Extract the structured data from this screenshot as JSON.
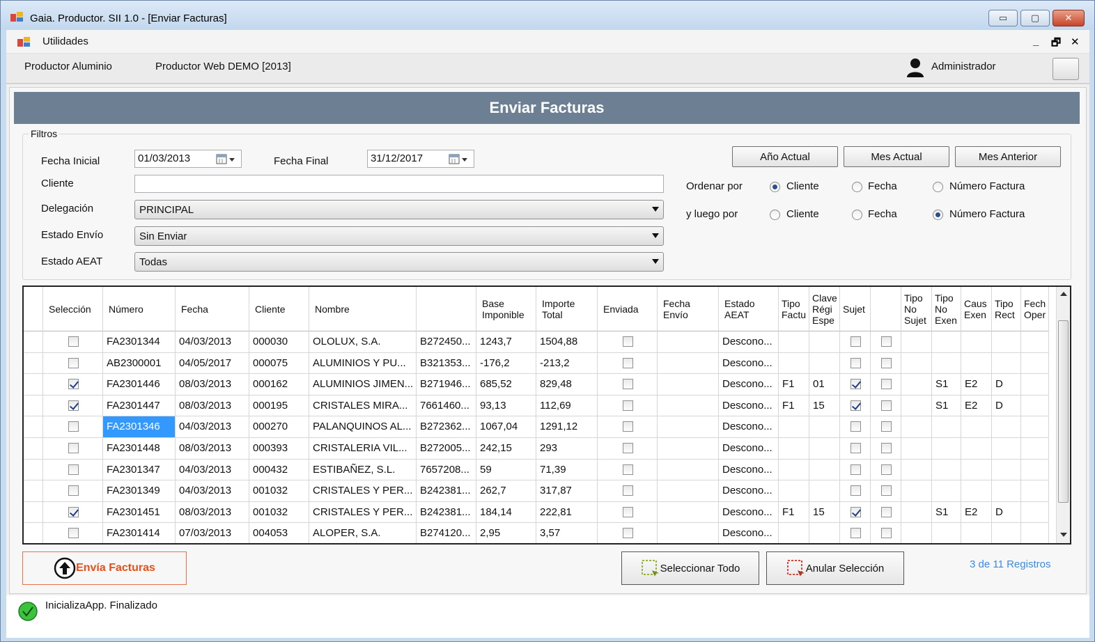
{
  "window": {
    "title": "Gaia. Productor. SII 1.0 - [Enviar Facturas]",
    "controls": {
      "minimize": "▭",
      "maximize": "▢",
      "close": "✕"
    }
  },
  "menu": {
    "items": [
      "Utilidades"
    ],
    "mdi": {
      "minimize": "_",
      "restore": "🗗",
      "close": "✕"
    }
  },
  "info": {
    "company": "Productor Aluminio",
    "environment": "Productor Web DEMO [2013]",
    "user": "Administrador"
  },
  "page": {
    "title": "Enviar Facturas"
  },
  "filters": {
    "legend": "Filtros",
    "fecha_inicial_label": "Fecha Inicial",
    "fecha_inicial": "01/03/2013",
    "fecha_final_label": "Fecha Final",
    "fecha_final": "31/12/2017",
    "cliente_label": "Cliente",
    "cliente_value": "",
    "delegacion_label": "Delegación",
    "delegacion": "PRINCIPAL",
    "estado_envio_label": "Estado Envío",
    "estado_envio": "Sin Enviar",
    "estado_aeat_label": "Estado AEAT",
    "estado_aeat": "Todas",
    "buttons": {
      "anio_actual": "Año Actual",
      "mes_actual": "Mes Actual",
      "mes_anterior": "Mes Anterior"
    },
    "ordenar_label": "Ordenar por",
    "luego_label": "y luego por",
    "radio_options": [
      "Cliente",
      "Fecha",
      "Número Factura"
    ],
    "ordenar_selected": 0,
    "luego_selected": 2
  },
  "grid": {
    "headers": [
      "Selección",
      "Número",
      "Fecha",
      "Cliente",
      "Nombre",
      "",
      "Base\nImponible",
      "Importe\nTotal",
      "Enviada",
      "Fecha\nEnvío",
      "Estado\nAEAT",
      "Tipo\nFactu",
      "Clave\nRégi\nEspe",
      "Sujet",
      "",
      "Tipo\nNo\nSujet",
      "Tipo\nNo\nExen",
      "Caus\nExen",
      "Tipo\nRect",
      "Fech\nOper"
    ],
    "rows": [
      {
        "sel": false,
        "numero": "FA2301344",
        "fecha": "04/03/2013",
        "cliente": "000030",
        "nombre": "OLOLUX, S.A.",
        "nif": "B272450...",
        "base": "1243,7",
        "total": "1504,88",
        "enviada": false,
        "fenvio": "",
        "estado": "Descono...",
        "tipo": "",
        "clave": "",
        "sujeta": false,
        "extra": false,
        "tns": "",
        "tne": "",
        "caus": "",
        "rect": "",
        "foper": ""
      },
      {
        "sel": false,
        "numero": "AB2300001",
        "fecha": "04/05/2017",
        "cliente": "000075",
        "nombre": "ALUMINIOS Y PU...",
        "nif": "B321353...",
        "base": "-176,2",
        "total": "-213,2",
        "enviada": false,
        "fenvio": "",
        "estado": "Descono...",
        "tipo": "",
        "clave": "",
        "sujeta": false,
        "extra": false,
        "tns": "",
        "tne": "",
        "caus": "",
        "rect": "",
        "foper": ""
      },
      {
        "sel": true,
        "numero": "FA2301446",
        "fecha": "08/03/2013",
        "cliente": "000162",
        "nombre": "ALUMINIOS JIMEN...",
        "nif": "B271946...",
        "base": "685,52",
        "total": "829,48",
        "enviada": false,
        "fenvio": "",
        "estado": "Descono...",
        "tipo": "F1",
        "clave": "01",
        "sujeta": true,
        "extra": false,
        "tns": "",
        "tne": "S1",
        "caus": "E2",
        "rect": "D",
        "foper": ""
      },
      {
        "sel": true,
        "numero": "FA2301447",
        "fecha": "08/03/2013",
        "cliente": "000195",
        "nombre": "CRISTALES MIRA...",
        "nif": "7661460...",
        "base": "93,13",
        "total": "112,69",
        "enviada": false,
        "fenvio": "",
        "estado": "Descono...",
        "tipo": "F1",
        "clave": "15",
        "sujeta": true,
        "extra": false,
        "tns": "",
        "tne": "S1",
        "caus": "E2",
        "rect": "D",
        "foper": ""
      },
      {
        "sel": false,
        "numero": "FA2301346",
        "fecha": "04/03/2013",
        "cliente": "000270",
        "nombre": "PALANQUINOS AL...",
        "nif": "B272362...",
        "base": "1067,04",
        "total": "1291,12",
        "enviada": false,
        "fenvio": "",
        "estado": "Descono...",
        "tipo": "",
        "clave": "",
        "sujeta": false,
        "extra": false,
        "tns": "",
        "tne": "",
        "caus": "",
        "rect": "",
        "foper": "",
        "highlight": true
      },
      {
        "sel": false,
        "numero": "FA2301448",
        "fecha": "08/03/2013",
        "cliente": "000393",
        "nombre": "CRISTALERIA VIL...",
        "nif": "B272005...",
        "base": "242,15",
        "total": "293",
        "enviada": false,
        "fenvio": "",
        "estado": "Descono...",
        "tipo": "",
        "clave": "",
        "sujeta": false,
        "extra": false,
        "tns": "",
        "tne": "",
        "caus": "",
        "rect": "",
        "foper": ""
      },
      {
        "sel": false,
        "numero": "FA2301347",
        "fecha": "04/03/2013",
        "cliente": "000432",
        "nombre": "ESTIBAÑEZ, S.L.",
        "nif": "7657208...",
        "base": "59",
        "total": "71,39",
        "enviada": false,
        "fenvio": "",
        "estado": "Descono...",
        "tipo": "",
        "clave": "",
        "sujeta": false,
        "extra": false,
        "tns": "",
        "tne": "",
        "caus": "",
        "rect": "",
        "foper": ""
      },
      {
        "sel": false,
        "numero": "FA2301349",
        "fecha": "04/03/2013",
        "cliente": "001032",
        "nombre": "CRISTALES Y PER...",
        "nif": "B242381...",
        "base": "262,7",
        "total": "317,87",
        "enviada": false,
        "fenvio": "",
        "estado": "Descono...",
        "tipo": "",
        "clave": "",
        "sujeta": false,
        "extra": false,
        "tns": "",
        "tne": "",
        "caus": "",
        "rect": "",
        "foper": ""
      },
      {
        "sel": true,
        "numero": "FA2301451",
        "fecha": "08/03/2013",
        "cliente": "001032",
        "nombre": "CRISTALES Y PER...",
        "nif": "B242381...",
        "base": "184,14",
        "total": "222,81",
        "enviada": false,
        "fenvio": "",
        "estado": "Descono...",
        "tipo": "F1",
        "clave": "15",
        "sujeta": true,
        "extra": false,
        "tns": "",
        "tne": "S1",
        "caus": "E2",
        "rect": "D",
        "foper": ""
      },
      {
        "sel": false,
        "numero": "FA2301414",
        "fecha": "07/03/2013",
        "cliente": "004053",
        "nombre": "ALOPER, S.A.",
        "nif": "B274120...",
        "base": "2,95",
        "total": "3,57",
        "enviada": false,
        "fenvio": "",
        "estado": "Descono...",
        "tipo": "",
        "clave": "",
        "sujeta": false,
        "extra": false,
        "tns": "",
        "tne": "",
        "caus": "",
        "rect": "",
        "foper": ""
      }
    ]
  },
  "actions": {
    "envia": "Envía Facturas",
    "seleccionar_todo": "Seleccionar Todo",
    "anular_seleccion": "Anular Selección",
    "records": "3 de 11 Registros"
  },
  "status": {
    "text": "InicializaApp. Finalizado"
  },
  "icons": {
    "app": "app-icon",
    "user": "user-icon",
    "calendar": "calendar-icon",
    "upload": "upload-arrow-icon",
    "select_all": "select-all-icon",
    "deselect": "deselect-icon",
    "status": "check-circle-icon"
  },
  "colors": {
    "banner": "#6d7f93",
    "accent": "#e8501a",
    "link": "#3b8ae0",
    "selection": "#3399ff"
  }
}
